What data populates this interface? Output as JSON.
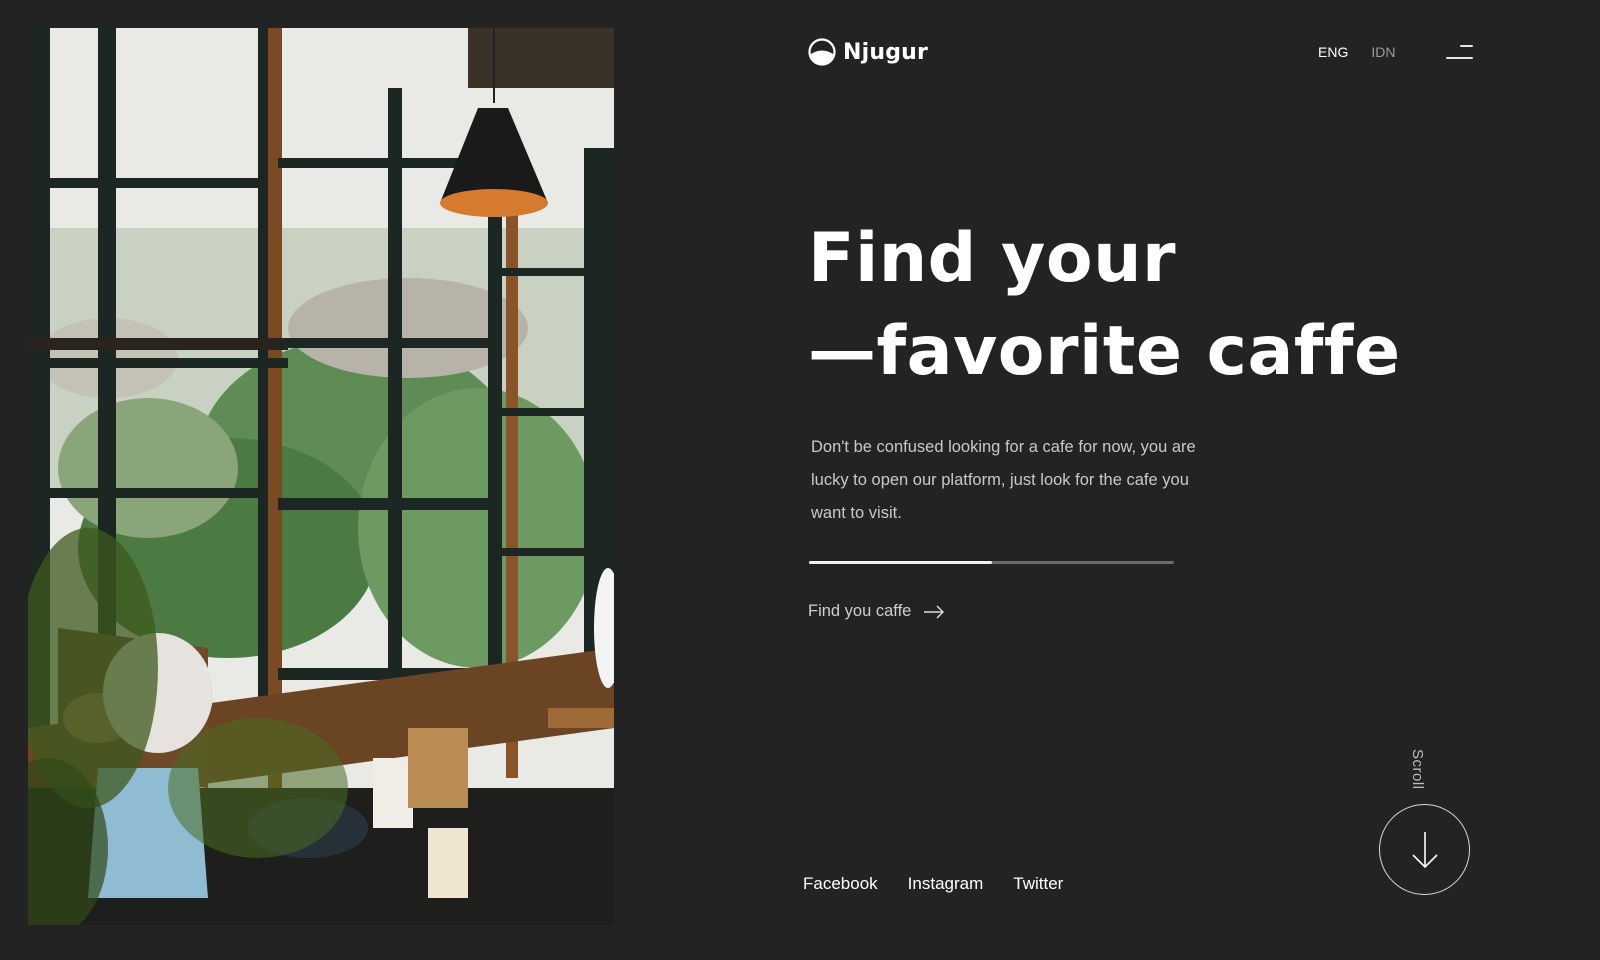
{
  "brand": {
    "name": "Njugur",
    "logo_icon": "half-circle-logo-icon"
  },
  "header": {
    "languages": [
      {
        "label": "ENG",
        "active": true
      },
      {
        "label": "IDN",
        "active": false
      }
    ],
    "menu_icon": "hamburger-menu-icon"
  },
  "hero": {
    "headline_line1": "Find your",
    "headline_line2": "—favorite caffe",
    "description": "Don't be confused looking for a cafe for now, you are lucky to open our platform, just look for the cafe you want to visit.",
    "slider_progress": 0.5,
    "cta_label": "Find you caffe",
    "cta_icon": "arrow-right-icon",
    "photo": "cafe-window-interior-photo"
  },
  "socials": [
    {
      "label": "Facebook"
    },
    {
      "label": "Instagram"
    },
    {
      "label": "Twitter"
    }
  ],
  "scroll": {
    "label": "Scroll",
    "icon": "arrow-down-icon"
  },
  "colors": {
    "background": "#232323",
    "text_primary": "#ffffff",
    "text_muted": "#9a9a9a",
    "progress_track": "#6b6b6b",
    "progress_fill": "#f2f2f2"
  }
}
